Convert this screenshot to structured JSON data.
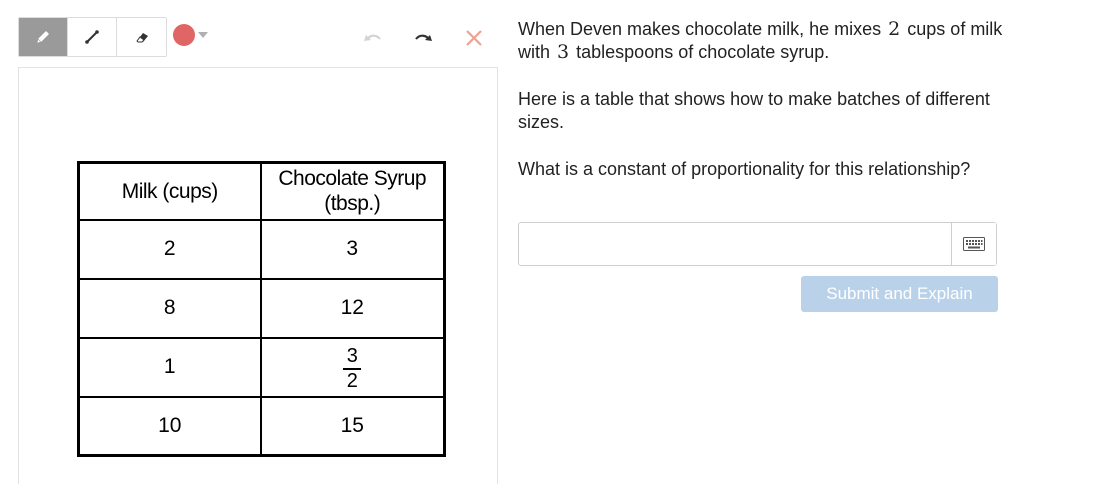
{
  "toolbar": {
    "tools": [
      {
        "name": "pencil",
        "icon": "pencil-icon",
        "active": true
      },
      {
        "name": "line",
        "icon": "line-icon",
        "active": false
      },
      {
        "name": "eraser",
        "icon": "eraser-icon",
        "active": false
      }
    ],
    "pen_color": "#e06666",
    "actions": [
      "undo-icon",
      "redo-icon",
      "close-icon"
    ]
  },
  "table": {
    "headers": [
      "Milk (cups)",
      "Chocolate Syrup (tbsp.)"
    ],
    "header_col2_line1": "Chocolate Syrup",
    "header_col2_line2": "(tbsp.)",
    "rows": [
      {
        "milk": "2",
        "syrup": "3"
      },
      {
        "milk": "8",
        "syrup": "12"
      },
      {
        "milk": "1",
        "syrup_num": "3",
        "syrup_den": "2"
      },
      {
        "milk": "10",
        "syrup": "15"
      }
    ]
  },
  "question": {
    "p1_a": "When Deven makes chocolate milk, he mixes",
    "p1_n1": "2",
    "p1_b": "cups of milk with",
    "p1_n2": "3",
    "p1_c": "tablespoons of chocolate syrup.",
    "p2": "Here is a table that shows how to make batches of different sizes.",
    "p3": "What is a constant of proportionality for this relationship?"
  },
  "answer": {
    "value": "",
    "placeholder": ""
  },
  "submit_label": "Submit and Explain",
  "colors": {
    "submit_bg": "#b9d2ea",
    "active_tool_bg": "#9a9a9a"
  }
}
